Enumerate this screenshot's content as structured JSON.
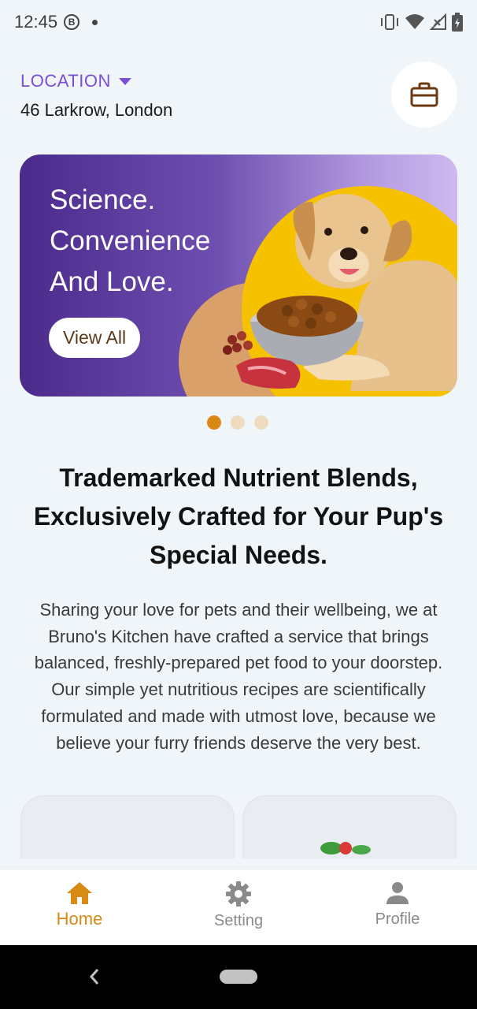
{
  "status_bar": {
    "time": "12:45",
    "badge": "B"
  },
  "header": {
    "location_label": "LOCATION",
    "address": "46 Larkrow, London",
    "cart_icon": "briefcase-icon"
  },
  "banner": {
    "lines": [
      "Science.",
      "Convenience",
      "And Love."
    ],
    "button_label": "View All"
  },
  "carousel": {
    "active_index": 0,
    "count": 3,
    "active_color": "#d88a14",
    "inactive_color": "#efdcbf"
  },
  "content": {
    "headline_lines": [
      "Trademarked Nutrient Blends,",
      "Exclusively Crafted for Your Pup's",
      "Special Needs."
    ],
    "description": "Sharing your love for pets and their wellbeing, we at Bruno's Kitchen have crafted a service that brings balanced, freshly-prepared pet food to your doorstep. Our simple yet nutritious recipes are scientifically formulated and made with utmost love, because we believe your furry friends deserve the very best."
  },
  "bottom_nav": {
    "items": [
      {
        "label": "Home",
        "icon": "home-icon",
        "active": true
      },
      {
        "label": "Setting",
        "icon": "gear-icon",
        "active": false
      },
      {
        "label": "Profile",
        "icon": "person-icon",
        "active": false
      }
    ],
    "active_color": "#d88a14",
    "inactive_color": "#8a8a8a"
  },
  "colors": {
    "accent_purple": "#7a4fd6",
    "accent_orange": "#d88a14",
    "background": "#f0f5f9"
  }
}
